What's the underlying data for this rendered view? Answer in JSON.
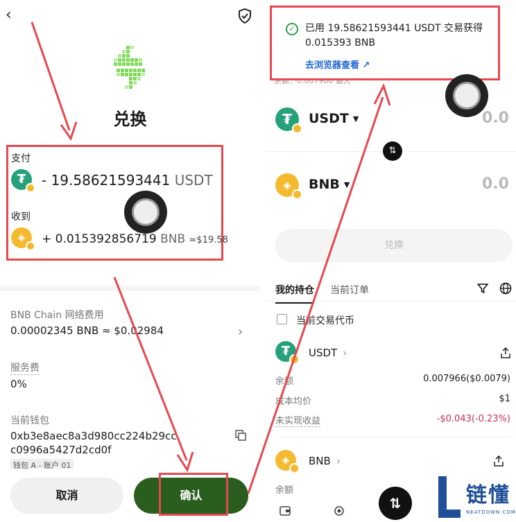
{
  "left": {
    "title": "兑换",
    "pay_label": "支付",
    "pay_amount": "- 19.58621593441",
    "pay_unit": "USDT",
    "receive_label": "收到",
    "receive_amount": "+ 0.015392856719",
    "receive_unit": "BNB",
    "receive_fiat": "≈$19.58",
    "fee_label": "BNB Chain 网络费用",
    "fee_value": "0.00002345 BNB ≈ $0.02984",
    "service_label": "服务费",
    "service_value": "0%",
    "wallet_label": "当前钱包",
    "wallet_address_line1": "0xb3e8aec8a3d980cc224b29cc",
    "wallet_address_line2": "c0996a5427d2cd0f",
    "wallet_tag": "钱包 A - 账户 01",
    "cancel_label": "取消",
    "confirm_label": "确认"
  },
  "right": {
    "toast_message": "已用 19.58621593441 USDT 交易获得 0.015393 BNB",
    "toast_link": "去浏览器查看",
    "balance_peek": "余额：0.007966  最大",
    "from_token": "USDT",
    "from_value": "0.0",
    "to_token": "BNB",
    "to_value": "0.0",
    "swap_button": "兑换",
    "tab_holdings": "我的持仓",
    "tab_orders": "当前订单",
    "current_pair_label": "当前交易代币",
    "holding1": {
      "name": "USDT",
      "balance_label": "余额",
      "balance_value": "0.007966($0.0079)",
      "cost_label": "成本均价",
      "cost_value": "$1",
      "pnl_label": "未实现收益",
      "pnl_value": "-$0.043(-0.23%)"
    },
    "holding2": {
      "name": "BNB",
      "balance_label": "余额"
    }
  },
  "watermark": {
    "text": "链懂",
    "sub": "NEATDOWN.COM"
  },
  "colors": {
    "annotation_red": "#e8474e",
    "confirm_green": "#295e1f",
    "usdt_green": "#26a17b",
    "bnb_yellow": "#f3ba2f",
    "link_blue": "#2166d4",
    "negative": "#c62e5a"
  },
  "icons": [
    "back-arrow-icon",
    "shield-check-icon",
    "swap-logo-icon",
    "chevron-right-icon",
    "copy-icon",
    "check-circle-icon",
    "external-link-icon",
    "switch-arrows-icon",
    "filter-icon",
    "globe-icon",
    "share-icon",
    "wallet-icon",
    "coin-icon",
    "swap-fab-icon"
  ]
}
